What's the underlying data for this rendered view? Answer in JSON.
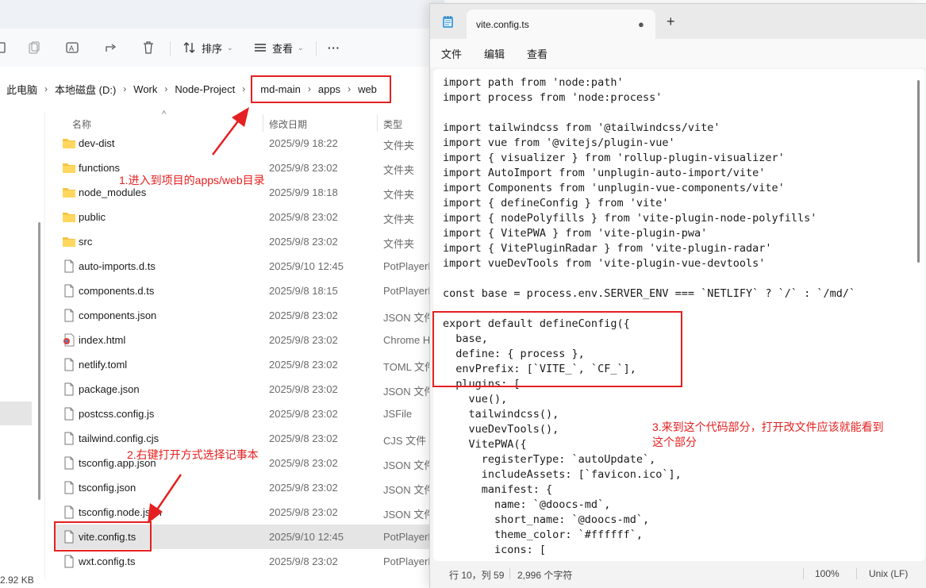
{
  "explorer": {
    "toolbar": {
      "sort_label": "排序",
      "view_label": "查看",
      "more_label": "···"
    },
    "breadcrumb": [
      "此电脑",
      "本地磁盘 (D:)",
      "Work",
      "Node-Project",
      "md-main",
      "apps",
      "web"
    ],
    "columns": {
      "name": "名称",
      "date": "修改日期",
      "type": "类型"
    },
    "files": [
      {
        "name": "dev-dist",
        "date": "2025/9/9 18:22",
        "type": "文件夹",
        "icon": "folder-icon"
      },
      {
        "name": "functions",
        "date": "2025/9/8 23:02",
        "type": "文件夹",
        "icon": "folder-icon"
      },
      {
        "name": "node_modules",
        "date": "2025/9/9 18:18",
        "type": "文件夹",
        "icon": "folder-icon"
      },
      {
        "name": "public",
        "date": "2025/9/8 23:02",
        "type": "文件夹",
        "icon": "folder-icon"
      },
      {
        "name": "src",
        "date": "2025/9/8 23:02",
        "type": "文件夹",
        "icon": "folder-icon"
      },
      {
        "name": "auto-imports.d.ts",
        "date": "2025/9/10 12:45",
        "type": "PotPlayerM",
        "icon": "file-icon"
      },
      {
        "name": "components.d.ts",
        "date": "2025/9/8 18:15",
        "type": "PotPlayerM",
        "icon": "file-icon"
      },
      {
        "name": "components.json",
        "date": "2025/9/8 23:02",
        "type": "JSON 文件",
        "icon": "file-icon"
      },
      {
        "name": "index.html",
        "date": "2025/9/8 23:02",
        "type": "Chrome H",
        "icon": "chrome-icon"
      },
      {
        "name": "netlify.toml",
        "date": "2025/9/8 23:02",
        "type": "TOML 文件",
        "icon": "file-icon"
      },
      {
        "name": "package.json",
        "date": "2025/9/8 23:02",
        "type": "JSON 文件",
        "icon": "file-icon"
      },
      {
        "name": "postcss.config.js",
        "date": "2025/9/8 23:02",
        "type": "JSFile",
        "icon": "file-icon"
      },
      {
        "name": "tailwind.config.cjs",
        "date": "2025/9/8 23:02",
        "type": "CJS 文件",
        "icon": "file-icon"
      },
      {
        "name": "tsconfig.app.json",
        "date": "2025/9/8 23:02",
        "type": "JSON 文件",
        "icon": "file-icon"
      },
      {
        "name": "tsconfig.json",
        "date": "2025/9/8 23:02",
        "type": "JSON 文件",
        "icon": "file-icon"
      },
      {
        "name": "tsconfig.node.json",
        "date": "2025/9/8 23:02",
        "type": "JSON 文件",
        "icon": "file-icon"
      },
      {
        "name": "vite.config.ts",
        "date": "2025/9/10 12:45",
        "type": "PotPlayerM",
        "icon": "file-icon",
        "selected": true
      },
      {
        "name": "wxt.config.ts",
        "date": "2025/9/8 23:02",
        "type": "PotPlayerM",
        "icon": "file-icon"
      }
    ],
    "status_size": "2.92 KB"
  },
  "annotations": {
    "step1": "1.进入到项目的apps/web目录",
    "step2": "2.右键打开方式选择记事本",
    "step3_line1": "3.来到这个代码部分，打开改文件应该就能看到",
    "step3_line2": "这个部分",
    "color": "#e52020"
  },
  "notepad": {
    "tab_title": "vite.config.ts",
    "tab_modified_dot": "●",
    "new_tab": "+",
    "menu": [
      "文件",
      "编辑",
      "查看"
    ],
    "code_lines": [
      "import path from 'node:path'",
      "import process from 'node:process'",
      "",
      "import tailwindcss from '@tailwindcss/vite'",
      "import vue from '@vitejs/plugin-vue'",
      "import { visualizer } from 'rollup-plugin-visualizer'",
      "import AutoImport from 'unplugin-auto-import/vite'",
      "import Components from 'unplugin-vue-components/vite'",
      "import { defineConfig } from 'vite'",
      "import { nodePolyfills } from 'vite-plugin-node-polyfills'",
      "import { VitePWA } from 'vite-plugin-pwa'",
      "import { VitePluginRadar } from 'vite-plugin-radar'",
      "import vueDevTools from 'vite-plugin-vue-devtools'",
      "",
      "const base = process.env.SERVER_ENV === `NETLIFY` ? `/` : `/md/`",
      "",
      "export default defineConfig({",
      "  base,",
      "  define: { process },",
      "  envPrefix: [`VITE_`, `CF_`],",
      "  plugins: [",
      "    vue(),",
      "    tailwindcss(),",
      "    vueDevTools(),",
      "    VitePWA({",
      "      registerType: `autoUpdate`,",
      "      includeAssets: [`favicon.ico`],",
      "      manifest: {",
      "        name: `@doocs-md`,",
      "        short_name: `@doocs-md`,",
      "        theme_color: `#ffffff`,",
      "        icons: ["
    ],
    "status": {
      "position": "行 10，列 59",
      "chars": "2,996 个字符",
      "zoom": "100%",
      "eol": "Unix (LF)"
    }
  }
}
